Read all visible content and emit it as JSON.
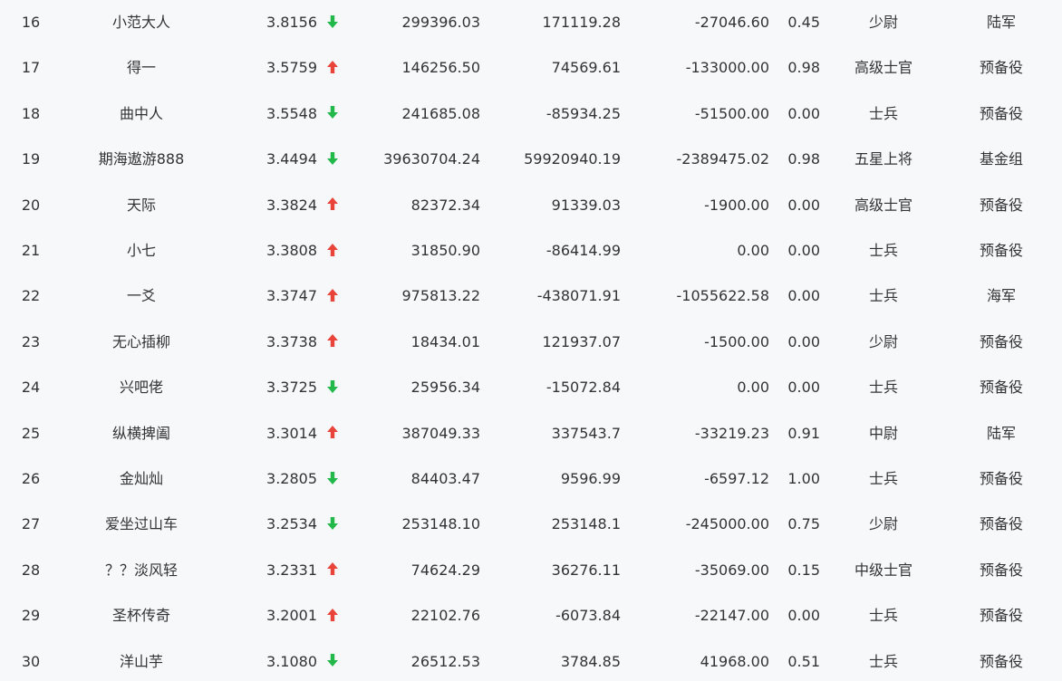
{
  "colors": {
    "up_arrow": "#e8443a",
    "down_arrow": "#22b84a",
    "text": "#333333",
    "background": "#f7f8fa"
  },
  "rows": [
    {
      "rank": "16",
      "name": "小范大人",
      "score": "3.8156",
      "trend": "down",
      "v1": "299396.03",
      "v2": "171119.28",
      "v3": "-27046.60",
      "v4": "0.45",
      "title": "少尉",
      "group": "陆军"
    },
    {
      "rank": "17",
      "name": "得一",
      "score": "3.5759",
      "trend": "up",
      "v1": "146256.50",
      "v2": "74569.61",
      "v3": "-133000.00",
      "v4": "0.98",
      "title": "高级士官",
      "group": "预备役"
    },
    {
      "rank": "18",
      "name": "曲中人",
      "score": "3.5548",
      "trend": "down",
      "v1": "241685.08",
      "v2": "-85934.25",
      "v3": "-51500.00",
      "v4": "0.00",
      "title": "士兵",
      "group": "预备役"
    },
    {
      "rank": "19",
      "name": "期海遨游888",
      "score": "3.4494",
      "trend": "down",
      "v1": "39630704.24",
      "v2": "59920940.19",
      "v3": "-2389475.02",
      "v4": "0.98",
      "title": "五星上将",
      "group": "基金组"
    },
    {
      "rank": "20",
      "name": "天际",
      "score": "3.3824",
      "trend": "up",
      "v1": "82372.34",
      "v2": "91339.03",
      "v3": "-1900.00",
      "v4": "0.00",
      "title": "高级士官",
      "group": "预备役"
    },
    {
      "rank": "21",
      "name": "小七",
      "score": "3.3808",
      "trend": "up",
      "v1": "31850.90",
      "v2": "-86414.99",
      "v3": "0.00",
      "v4": "0.00",
      "title": "士兵",
      "group": "预备役"
    },
    {
      "rank": "22",
      "name": "一爻",
      "score": "3.3747",
      "trend": "up",
      "v1": "975813.22",
      "v2": "-438071.91",
      "v3": "-1055622.58",
      "v4": "0.00",
      "title": "士兵",
      "group": "海军"
    },
    {
      "rank": "23",
      "name": "无心插柳",
      "score": "3.3738",
      "trend": "up",
      "v1": "18434.01",
      "v2": "121937.07",
      "v3": "-1500.00",
      "v4": "0.00",
      "title": "少尉",
      "group": "预备役"
    },
    {
      "rank": "24",
      "name": "兴吧佬",
      "score": "3.3725",
      "trend": "down",
      "v1": "25956.34",
      "v2": "-15072.84",
      "v3": "0.00",
      "v4": "0.00",
      "title": "士兵",
      "group": "预备役"
    },
    {
      "rank": "25",
      "name": "纵横捭阖",
      "score": "3.3014",
      "trend": "up",
      "v1": "387049.33",
      "v2": "337543.7",
      "v3": "-33219.23",
      "v4": "0.91",
      "title": "中尉",
      "group": "陆军"
    },
    {
      "rank": "26",
      "name": "金灿灿",
      "score": "3.2805",
      "trend": "down",
      "v1": "84403.47",
      "v2": "9596.99",
      "v3": "-6597.12",
      "v4": "1.00",
      "title": "士兵",
      "group": "预备役"
    },
    {
      "rank": "27",
      "name": "爱坐过山车",
      "score": "3.2534",
      "trend": "down",
      "v1": "253148.10",
      "v2": "253148.1",
      "v3": "-245000.00",
      "v4": "0.75",
      "title": "少尉",
      "group": "预备役"
    },
    {
      "rank": "28",
      "name": "？？淡风轻",
      "score": "3.2331",
      "trend": "up",
      "v1": "74624.29",
      "v2": "36276.11",
      "v3": "-35069.00",
      "v4": "0.15",
      "title": "中级士官",
      "group": "预备役"
    },
    {
      "rank": "29",
      "name": "圣杯传奇",
      "score": "3.2001",
      "trend": "up",
      "v1": "22102.76",
      "v2": "-6073.84",
      "v3": "-22147.00",
      "v4": "0.00",
      "title": "士兵",
      "group": "预备役"
    },
    {
      "rank": "30",
      "name": "洋山芋",
      "score": "3.1080",
      "trend": "down",
      "v1": "26512.53",
      "v2": "3784.85",
      "v3": "41968.00",
      "v4": "0.51",
      "title": "士兵",
      "group": "预备役"
    }
  ]
}
